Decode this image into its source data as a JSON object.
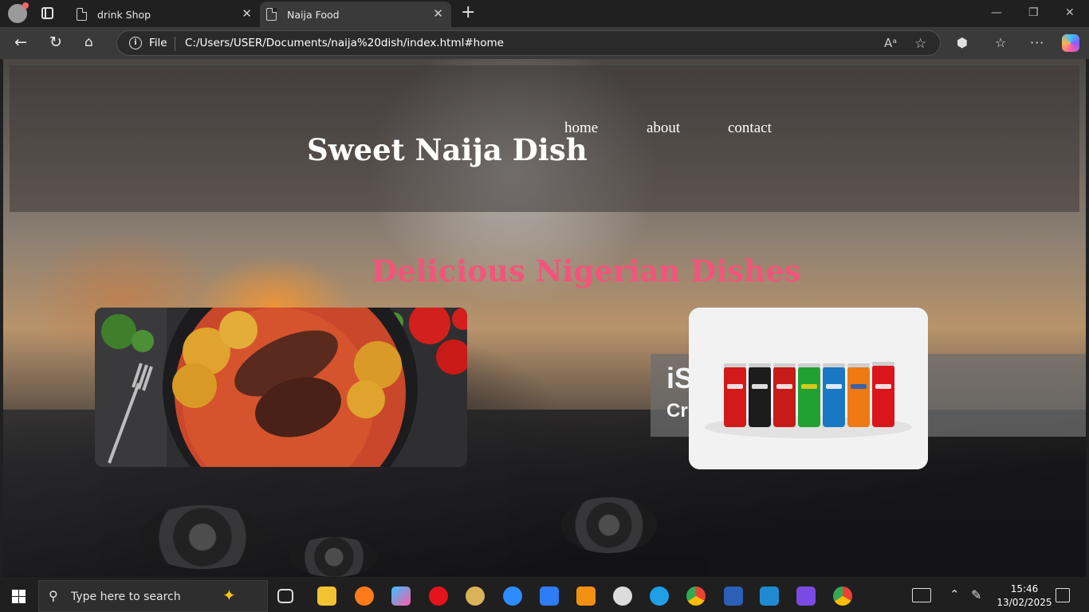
{
  "browser": {
    "tabs": [
      {
        "title": "drink Shop"
      },
      {
        "title": "Naija Food"
      }
    ],
    "new_tab": "+",
    "window_controls": {
      "minimize": "—",
      "restore": "❐",
      "close": "✕"
    },
    "address": {
      "scheme_label": "File",
      "url": "C:/Users/USER/Documents/naija%20dish/index.html#home"
    }
  },
  "page": {
    "site_title": "Sweet Naija Dish",
    "nav": [
      "home",
      "about",
      "contact"
    ],
    "hero_heading": "Delicious Nigerian Dishes",
    "ad_partial_text_1": "iS",
    "ad_partial_text_2": "Cr",
    "colors": {
      "heading_accent": "#f2557a",
      "header_overlay": "rgba(60,55,55,.55)"
    }
  },
  "taskbar": {
    "search_placeholder": "Type here to search",
    "time": "15:46",
    "date": "13/02/2025"
  }
}
